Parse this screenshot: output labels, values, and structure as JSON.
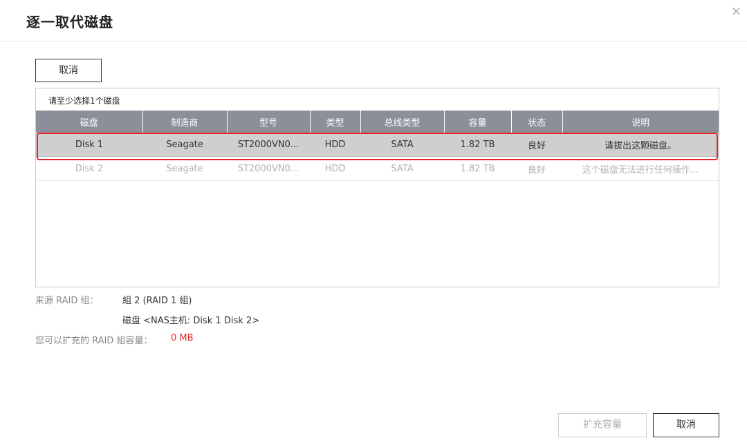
{
  "dialog": {
    "title": "逐一取代磁盘",
    "close_icon": "×",
    "cancel_top_label": "取消",
    "hint": "请至少选择1个磁盘"
  },
  "table": {
    "headers": [
      "磁盘",
      "制造商",
      "型号",
      "类型",
      "总线类型",
      "容量",
      "状态",
      "说明"
    ],
    "rows": [
      [
        "Disk 1",
        "Seagate",
        "ST2000VN0...",
        "HDD",
        "SATA",
        "1.82 TB",
        "良好",
        "请拔出这颗磁盘。"
      ],
      [
        "Disk 2",
        "Seagate",
        "ST2000VN0...",
        "HDD",
        "SATA",
        "1.82 TB",
        "良好",
        "这个磁盘无法进行任何操作..."
      ]
    ]
  },
  "info": {
    "source_label": "来源 RAID 组：",
    "source_group": "組 2 (RAID 1 組)",
    "source_disks": "磁盘 <NAS主机: Disk 1 Disk 2>",
    "capacity_label": "您可以扩充的 RAID 組容量：",
    "capacity_value": "0 MB"
  },
  "footer": {
    "expand_label": "扩充容量",
    "cancel_label": "取消"
  },
  "colors": {
    "header_bg": "#8a8f99",
    "selected_row_bg": "#cfcfcf",
    "highlight_border": "#e8262a",
    "warning_text": "#e8262a"
  }
}
